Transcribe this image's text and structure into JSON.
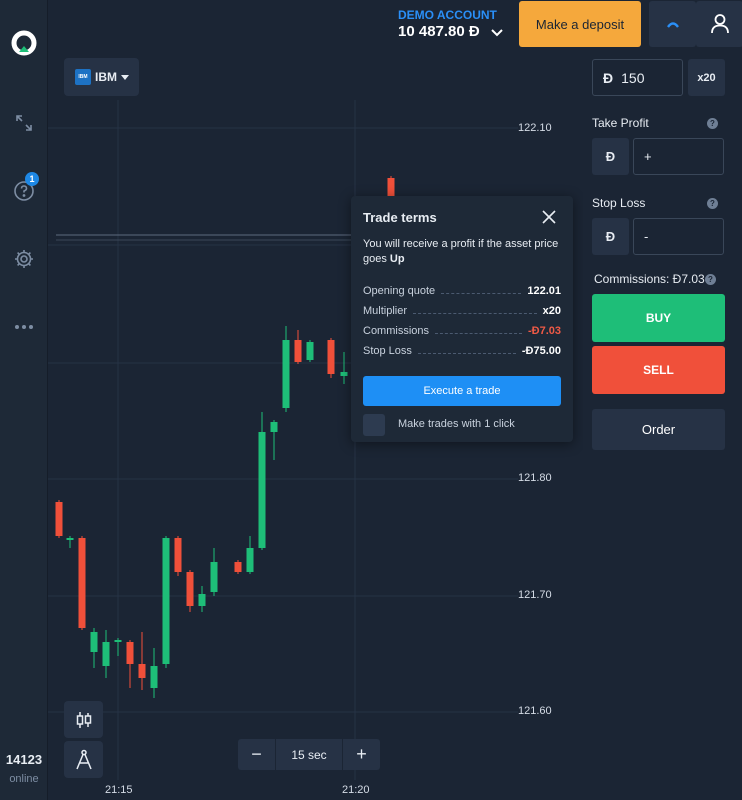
{
  "header": {
    "account_label": "DEMO ACCOUNT",
    "balance": "10 487.80 Đ",
    "deposit_label": "Make a deposit"
  },
  "sidebar": {
    "help_badge": "1",
    "online_count": "14123",
    "online_label": "online"
  },
  "chart": {
    "asset_name": "IBM",
    "asset_logo_text": "IBM",
    "price_ticks": [
      "122.10",
      "121.80",
      "121.70",
      "121.60"
    ],
    "time_ticks": [
      "21:15",
      "21:20"
    ],
    "timeframe": "15 sec",
    "timeframe_minus": "−",
    "timeframe_plus": "+"
  },
  "popup": {
    "title": "Trade terms",
    "desc_prefix": "You will receive a profit if the asset price goes ",
    "desc_direction": "Up",
    "terms": [
      {
        "label": "Opening quote",
        "value": "122.01"
      },
      {
        "label": "Multiplier",
        "value": "x20"
      },
      {
        "label": "Commissions",
        "value": "-Đ7.03"
      },
      {
        "label": "Stop Loss",
        "value": "-Đ75.00"
      }
    ],
    "execute_label": "Execute a trade",
    "oneclick_label": "Make trades with 1 click"
  },
  "panel": {
    "currency": "Đ",
    "amount": "150",
    "multiplier": "x20",
    "take_profit_label": "Take Profit",
    "take_profit_value": "+",
    "stop_loss_label": "Stop Loss",
    "stop_loss_value": "-",
    "commission_text": "Commissions: Đ7.03",
    "buy_label": "BUY",
    "sell_label": "SELL",
    "order_label": "Order"
  },
  "colors": {
    "up": "#1ebe78",
    "down": "#f0503a",
    "accent": "#1e8ff5",
    "deposit": "#f5a83c"
  }
}
